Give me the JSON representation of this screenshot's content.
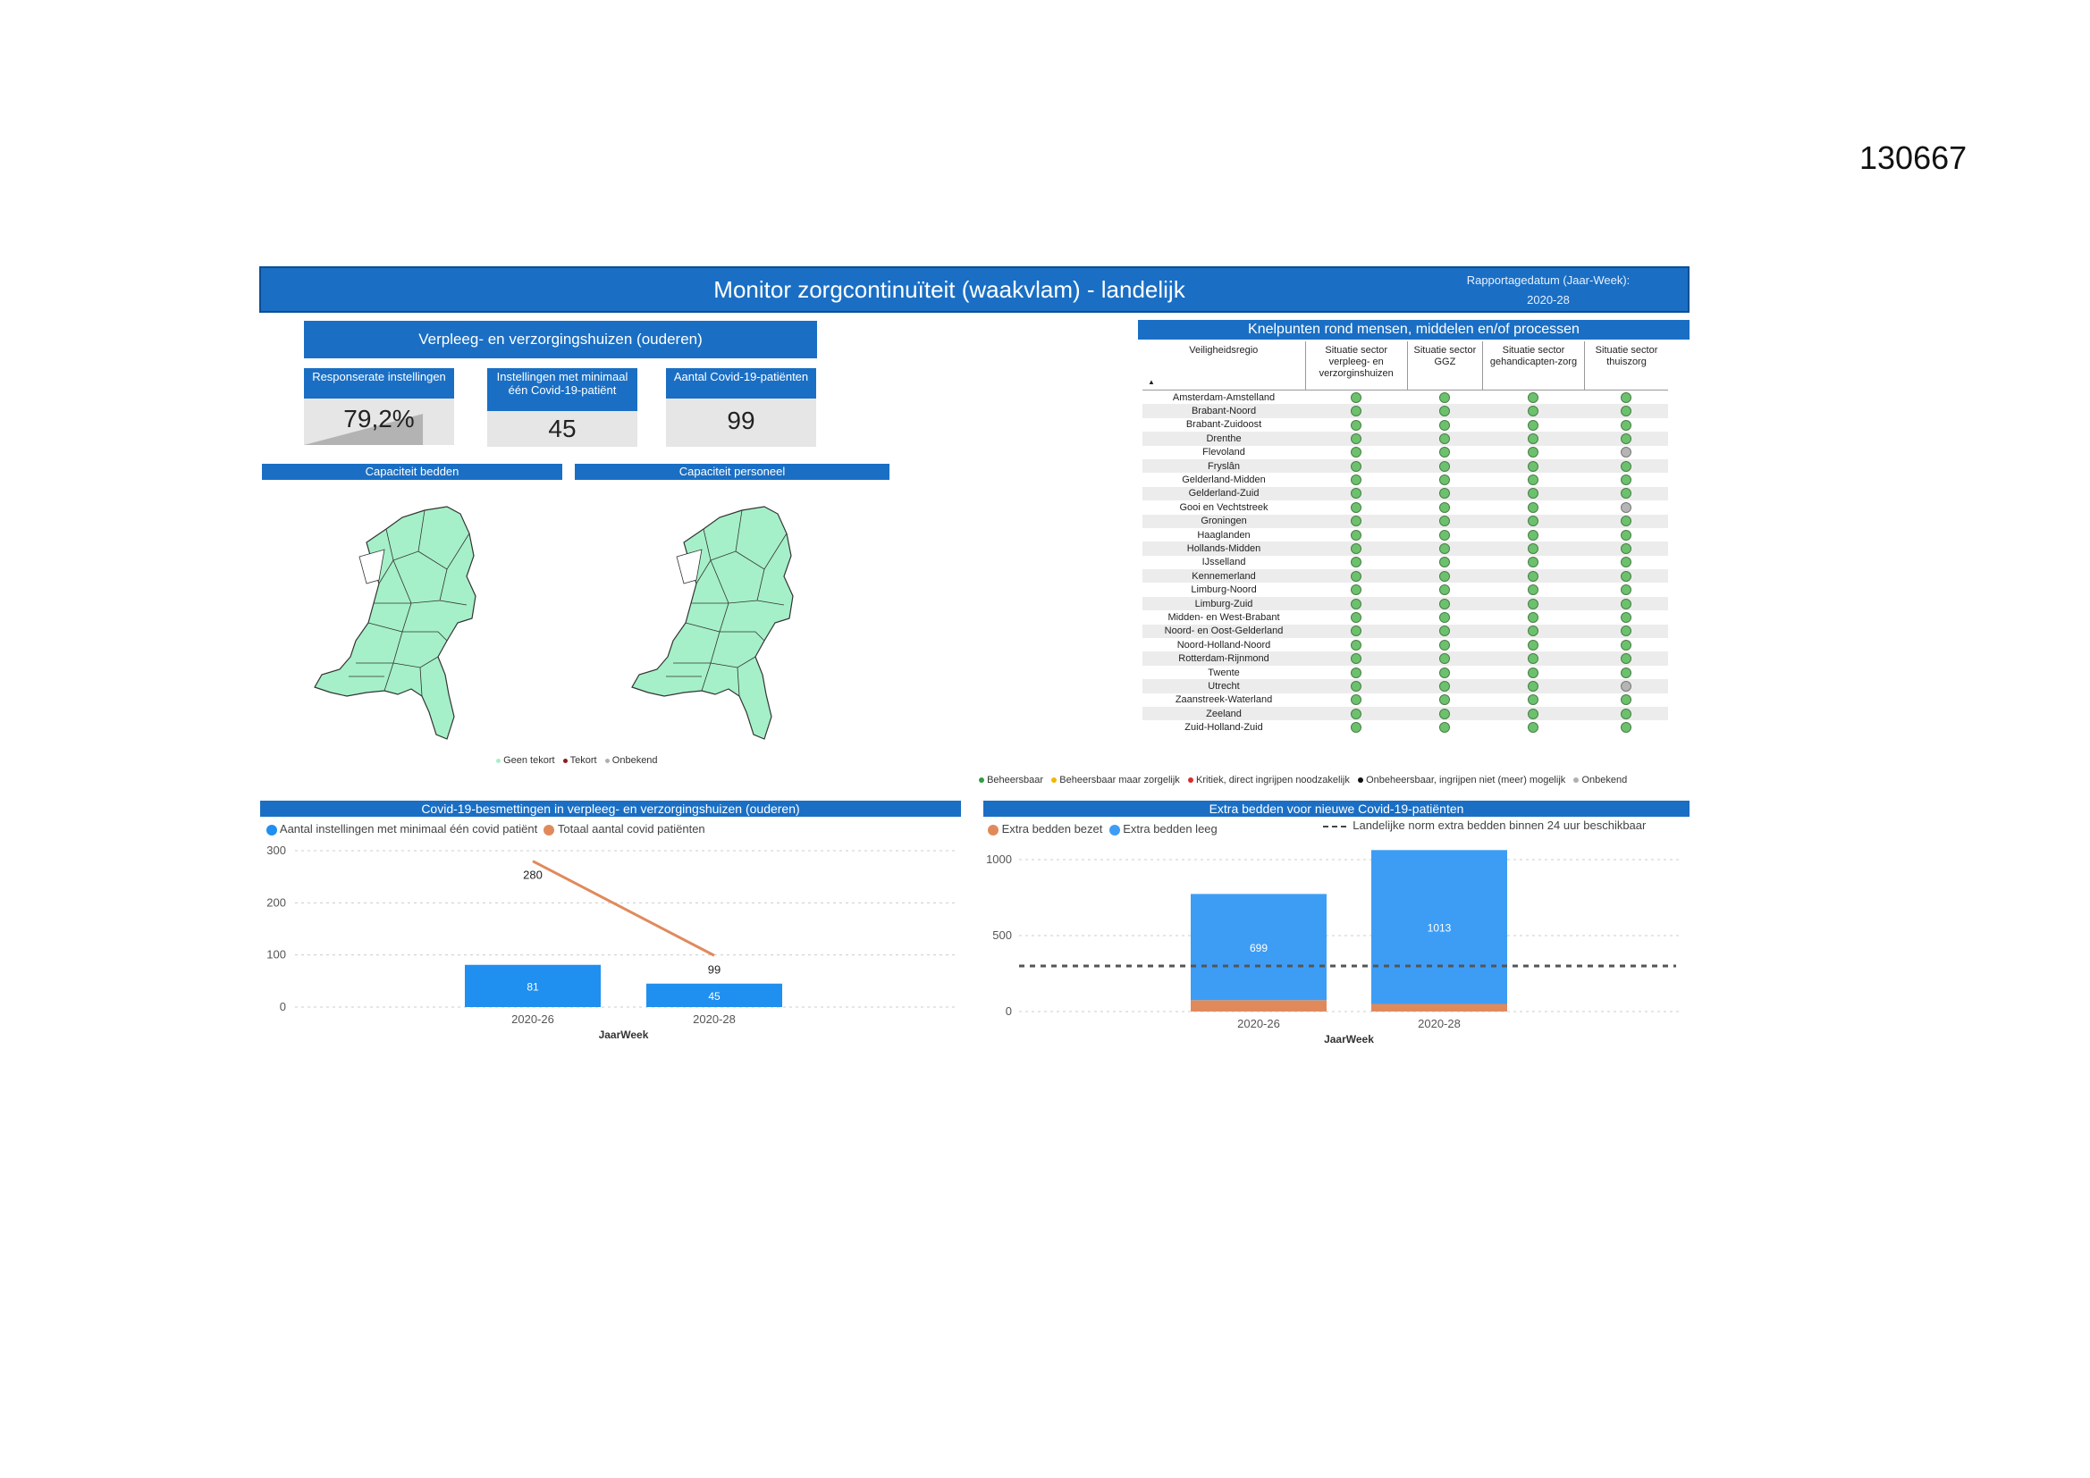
{
  "page_number": "130667",
  "header": {
    "title": "Monitor zorgcontinuïteit (waakvlam) - landelijk",
    "report_date_label": "Rapportagedatum (Jaar-Week):",
    "report_date_value": "2020-28"
  },
  "sector_banner": "Verpleeg- en verzorgingshuizen (ouderen)",
  "kpis": [
    {
      "title": "Responserate instellingen",
      "value": "79,2%",
      "fraction": 0.792
    },
    {
      "title": "Instellingen met minimaal één Covid-19-patiënt",
      "value": "45"
    },
    {
      "title": "Aantal Covid-19-patiënten",
      "value": "99"
    }
  ],
  "maps": {
    "beds_title": "Capaciteit bedden",
    "staff_title": "Capaciteit personeel",
    "fill_color": "#a5f0c8",
    "legend": [
      {
        "label": "Geen tekort",
        "color": "#a5f0c8"
      },
      {
        "label": "Tekort",
        "color": "#8b1e1e"
      },
      {
        "label": "Onbekend",
        "color": "#b0b0b0"
      }
    ]
  },
  "bottlenecks": {
    "title": "Knelpunten rond mensen, middelen en/of processen",
    "columns": [
      "Veiligheidsregio",
      "Situatie sector verpleeg- en verzorginshuizen",
      "Situatie sector GGZ",
      "Situatie sector gehandicapten-zorg",
      "Situatie sector thuiszorg"
    ],
    "status_colors": {
      "G": "#6cc26c",
      "O": "#b5b5b5"
    },
    "rows": [
      {
        "region": "Amsterdam-Amstelland",
        "status": [
          "G",
          "G",
          "G",
          "G"
        ]
      },
      {
        "region": "Brabant-Noord",
        "status": [
          "G",
          "G",
          "G",
          "G"
        ]
      },
      {
        "region": "Brabant-Zuidoost",
        "status": [
          "G",
          "G",
          "G",
          "G"
        ]
      },
      {
        "region": "Drenthe",
        "status": [
          "G",
          "G",
          "G",
          "G"
        ]
      },
      {
        "region": "Flevoland",
        "status": [
          "G",
          "G",
          "G",
          "O"
        ]
      },
      {
        "region": "Fryslân",
        "status": [
          "G",
          "G",
          "G",
          "G"
        ]
      },
      {
        "region": "Gelderland-Midden",
        "status": [
          "G",
          "G",
          "G",
          "G"
        ]
      },
      {
        "region": "Gelderland-Zuid",
        "status": [
          "G",
          "G",
          "G",
          "G"
        ]
      },
      {
        "region": "Gooi en Vechtstreek",
        "status": [
          "G",
          "G",
          "G",
          "O"
        ]
      },
      {
        "region": "Groningen",
        "status": [
          "G",
          "G",
          "G",
          "G"
        ]
      },
      {
        "region": "Haaglanden",
        "status": [
          "G",
          "G",
          "G",
          "G"
        ]
      },
      {
        "region": "Hollands-Midden",
        "status": [
          "G",
          "G",
          "G",
          "G"
        ]
      },
      {
        "region": "IJsselland",
        "status": [
          "G",
          "G",
          "G",
          "G"
        ]
      },
      {
        "region": "Kennemerland",
        "status": [
          "G",
          "G",
          "G",
          "G"
        ]
      },
      {
        "region": "Limburg-Noord",
        "status": [
          "G",
          "G",
          "G",
          "G"
        ]
      },
      {
        "region": "Limburg-Zuid",
        "status": [
          "G",
          "G",
          "G",
          "G"
        ]
      },
      {
        "region": "Midden- en West-Brabant",
        "status": [
          "G",
          "G",
          "G",
          "G"
        ]
      },
      {
        "region": "Noord- en Oost-Gelderland",
        "status": [
          "G",
          "G",
          "G",
          "G"
        ]
      },
      {
        "region": "Noord-Holland-Noord",
        "status": [
          "G",
          "G",
          "G",
          "G"
        ]
      },
      {
        "region": "Rotterdam-Rijnmond",
        "status": [
          "G",
          "G",
          "G",
          "G"
        ]
      },
      {
        "region": "Twente",
        "status": [
          "G",
          "G",
          "G",
          "G"
        ]
      },
      {
        "region": "Utrecht",
        "status": [
          "G",
          "G",
          "G",
          "O"
        ]
      },
      {
        "region": "Zaanstreek-Waterland",
        "status": [
          "G",
          "G",
          "G",
          "G"
        ]
      },
      {
        "region": "Zeeland",
        "status": [
          "G",
          "G",
          "G",
          "G"
        ]
      },
      {
        "region": "Zuid-Holland-Zuid",
        "status": [
          "G",
          "G",
          "G",
          "G"
        ]
      }
    ],
    "legend": [
      {
        "label": "Beheersbaar",
        "color": "#2e9e3e"
      },
      {
        "label": "Beheersbaar maar zorgelijk",
        "color": "#f2b705"
      },
      {
        "label": "Kritiek, direct ingrijpen noodzakelijk",
        "color": "#d62d2d"
      },
      {
        "label": "Onbeheersbaar, ingrijpen niet (meer) mogelijk",
        "color": "#111111"
      },
      {
        "label": "Onbekend",
        "color": "#b0b0b0"
      }
    ]
  },
  "chart_data": [
    {
      "type": "bar",
      "title": "Covid-19-besmettingen in verpleeg- en verzorgingshuizen (ouderen)",
      "xlabel": "JaarWeek",
      "ylabel": "",
      "categories": [
        "2020-26",
        "2020-28"
      ],
      "ylim": [
        0,
        300
      ],
      "yticks": [
        0,
        100,
        200,
        300
      ],
      "grid": true,
      "legend_position": "top-left",
      "series": [
        {
          "name": "Aantal instellingen met minimaal één covid patiënt",
          "type": "bar",
          "color": "#1f8ff0",
          "values": [
            81,
            45
          ]
        },
        {
          "name": "Totaal aantal covid patiënten",
          "type": "line",
          "color": "#e08a5c",
          "values": [
            280,
            99
          ]
        }
      ]
    },
    {
      "type": "bar",
      "title": "Extra bedden voor nieuwe Covid-19-patiënten",
      "xlabel": "JaarWeek",
      "ylabel": "",
      "categories": [
        "2020-26",
        "2020-28"
      ],
      "ylim": [
        0,
        1000
      ],
      "yticks": [
        0,
        500,
        1000
      ],
      "grid": true,
      "stacked": true,
      "legend_position": "top-left",
      "series": [
        {
          "name": "Extra bedden bezet",
          "color": "#e08a5c",
          "values": [
            75,
            50
          ]
        },
        {
          "name": "Extra bedden leeg",
          "color": "#3d9df5",
          "values": [
            699,
            1013
          ]
        }
      ],
      "reference_line": {
        "name": "Landelijke norm extra bedden binnen 24 uur beschikbaar",
        "value": 300,
        "style": "dashed"
      }
    }
  ]
}
